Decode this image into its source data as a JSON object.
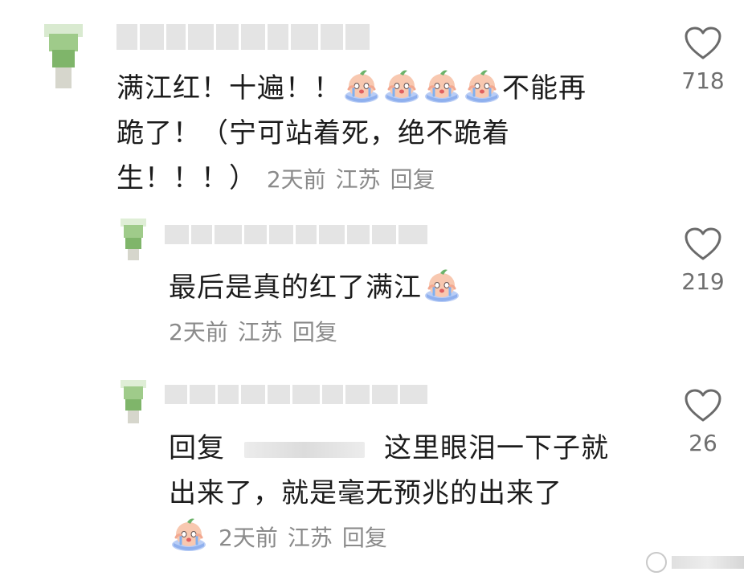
{
  "comments": [
    {
      "segments": [
        "满江红！十遍！！",
        "不能再",
        "跪了！（宁可站着死，绝不跪着",
        "生！！！）"
      ],
      "meta": {
        "time": "2天前",
        "location": "江苏",
        "reply": "回复"
      },
      "likes": "718"
    },
    {
      "segments": [
        "最后是真的红了满江"
      ],
      "meta": {
        "time": "2天前",
        "location": "江苏",
        "reply": "回复"
      },
      "likes": "219"
    },
    {
      "reply_prefix": "回复",
      "segments": [
        "这里眼泪一下子就",
        "出来了，就是毫无预兆的出来了"
      ],
      "meta": {
        "time": "2天前",
        "location": "江苏",
        "reply": "回复"
      },
      "likes": "26"
    }
  ],
  "icons": {
    "like": "heart-outline-icon",
    "emoji": "crying-peach-sticker-icon"
  },
  "colors": {
    "text": "#1c1c1c",
    "meta": "#8a8a8a",
    "like_count": "#6f6f6f",
    "avatar_green": "#8fbf7a"
  }
}
